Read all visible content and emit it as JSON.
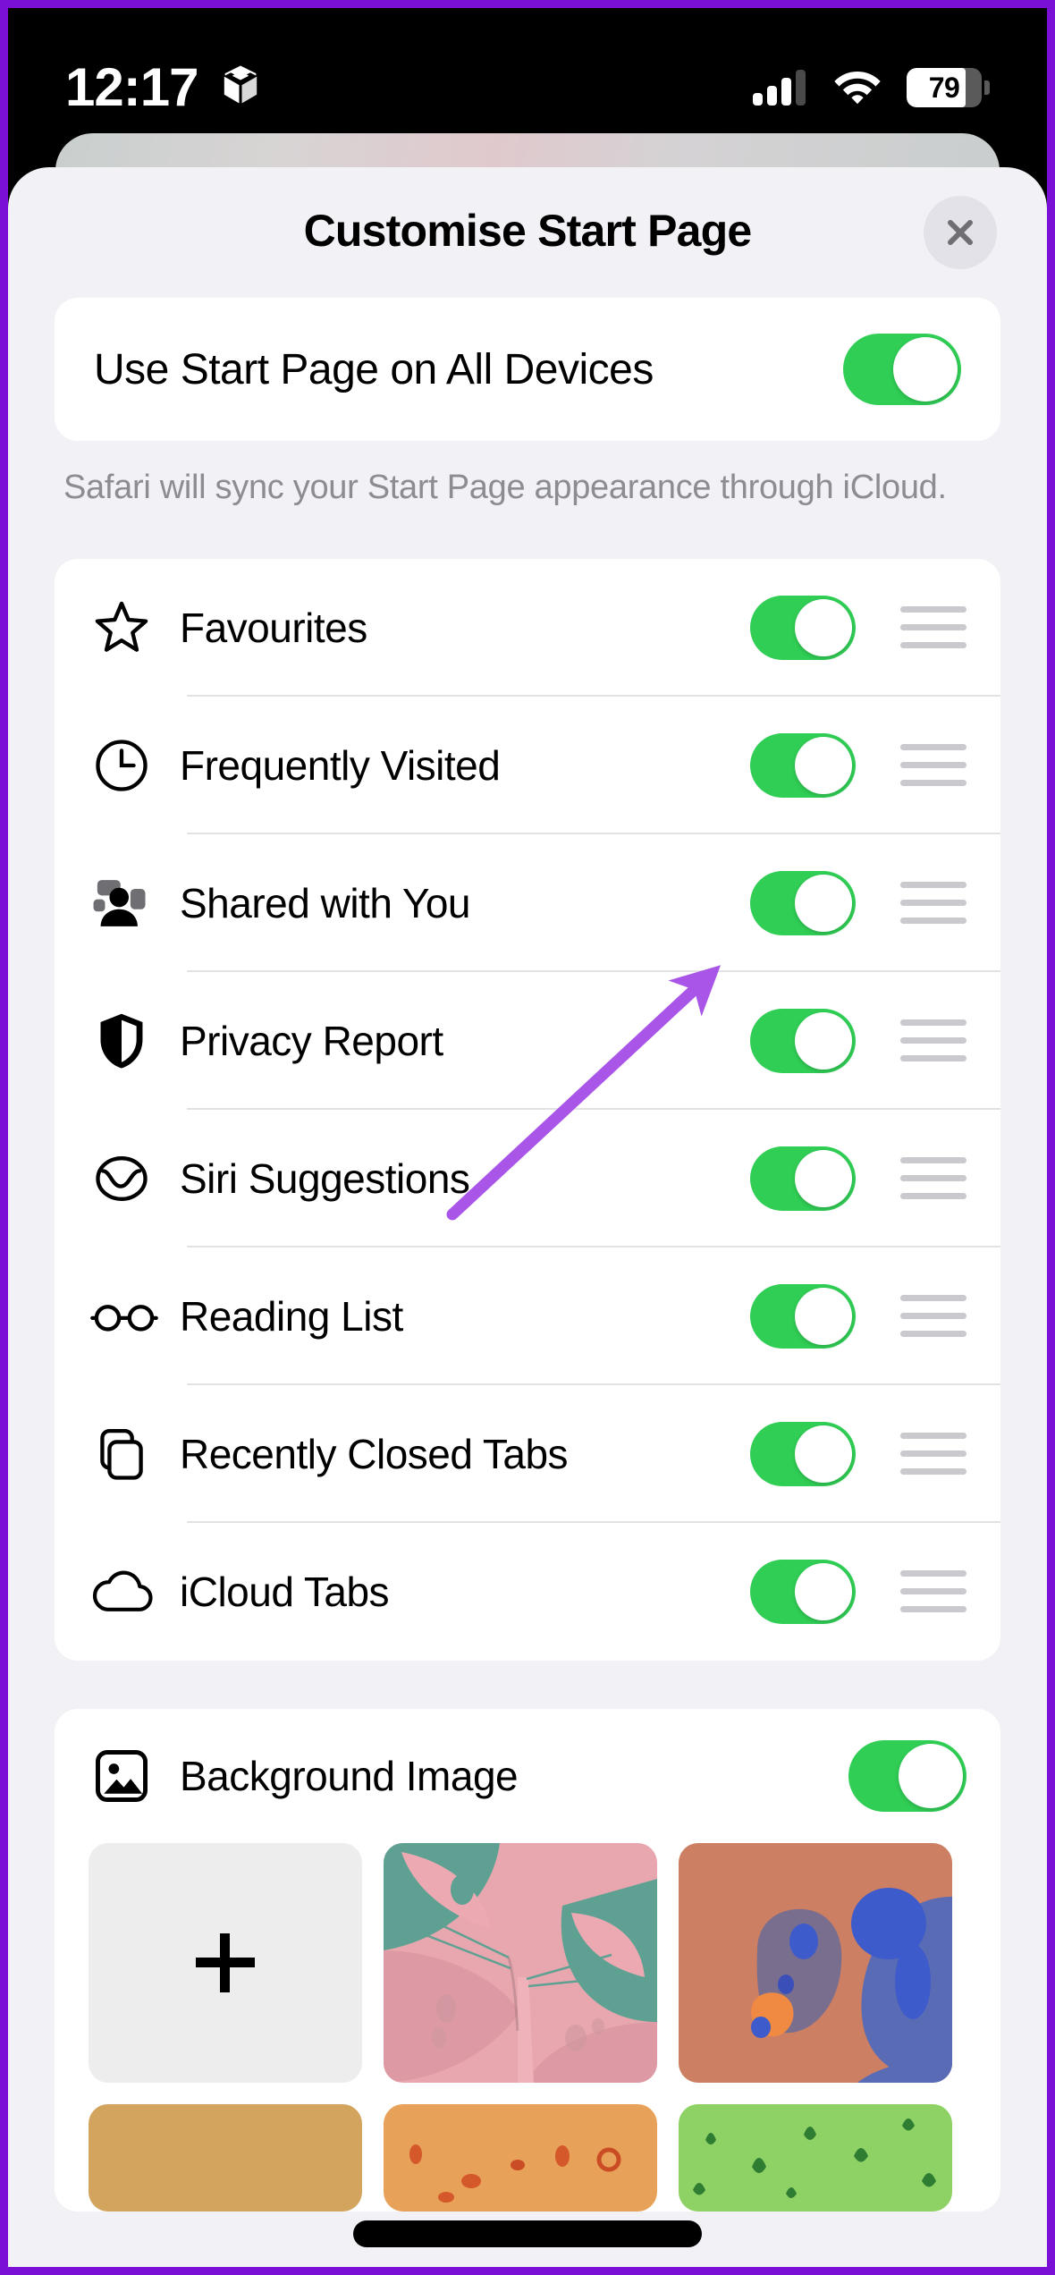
{
  "status_bar": {
    "time": "12:17",
    "left_icon": "cube-icon",
    "cellular_icon": "cellular-signal-icon",
    "cellular_bars_filled": 3,
    "cellular_bars_total": 4,
    "wifi_icon": "wifi-icon",
    "battery_icon": "battery-icon",
    "battery_percent": "79",
    "battery_level": 79
  },
  "sheet": {
    "title": "Customise Start Page",
    "close_icon": "close-icon"
  },
  "sync": {
    "label": "Use Start Page on All Devices",
    "toggle_on": true,
    "footnote": "Safari will sync your Start Page appearance through iCloud."
  },
  "sections": [
    {
      "icon": "star-icon",
      "label": "Favourites",
      "toggle_on": true,
      "handle": "drag-handle-icon"
    },
    {
      "icon": "clock-icon",
      "label": "Frequently Visited",
      "toggle_on": true,
      "handle": "drag-handle-icon"
    },
    {
      "icon": "shared-people-icon",
      "label": "Shared with You",
      "toggle_on": true,
      "handle": "drag-handle-icon"
    },
    {
      "icon": "shield-icon",
      "label": "Privacy Report",
      "toggle_on": true,
      "handle": "drag-handle-icon"
    },
    {
      "icon": "siri-icon",
      "label": "Siri Suggestions",
      "toggle_on": true,
      "handle": "drag-handle-icon"
    },
    {
      "icon": "glasses-icon",
      "label": "Reading List",
      "toggle_on": true,
      "handle": "drag-handle-icon"
    },
    {
      "icon": "tabs-icon",
      "label": "Recently Closed Tabs",
      "toggle_on": true,
      "handle": "drag-handle-icon"
    },
    {
      "icon": "cloud-icon",
      "label": "iCloud Tabs",
      "toggle_on": true,
      "handle": "drag-handle-icon"
    }
  ],
  "background_image": {
    "icon": "photo-icon",
    "label": "Background Image",
    "toggle_on": true,
    "thumbnails_row1": [
      {
        "name": "add-background-tile",
        "kind": "add",
        "plus_icon": "plus-icon"
      },
      {
        "name": "butterfly-wallpaper",
        "kind": "image"
      },
      {
        "name": "bear-wallpaper",
        "kind": "image"
      }
    ],
    "thumbnails_row2": [
      {
        "name": "tan-wallpaper",
        "kind": "image"
      },
      {
        "name": "orange-wallpaper",
        "kind": "image"
      },
      {
        "name": "green-wallpaper",
        "kind": "image"
      }
    ]
  },
  "annotation": {
    "type": "arrow",
    "points_at": "Shared with You toggle",
    "color": "#A855E8"
  },
  "colors": {
    "toggle_on": "#30CE55",
    "sheet_background": "#F2F1F6",
    "card_background": "#FFFFFF",
    "annotation_purple": "#A855E8",
    "frame_purple": "#7A10D6",
    "footnote_gray": "#8C8C93",
    "separator_gray": "#E2E2E5",
    "drag_handle_gray": "#C9C9CE"
  }
}
